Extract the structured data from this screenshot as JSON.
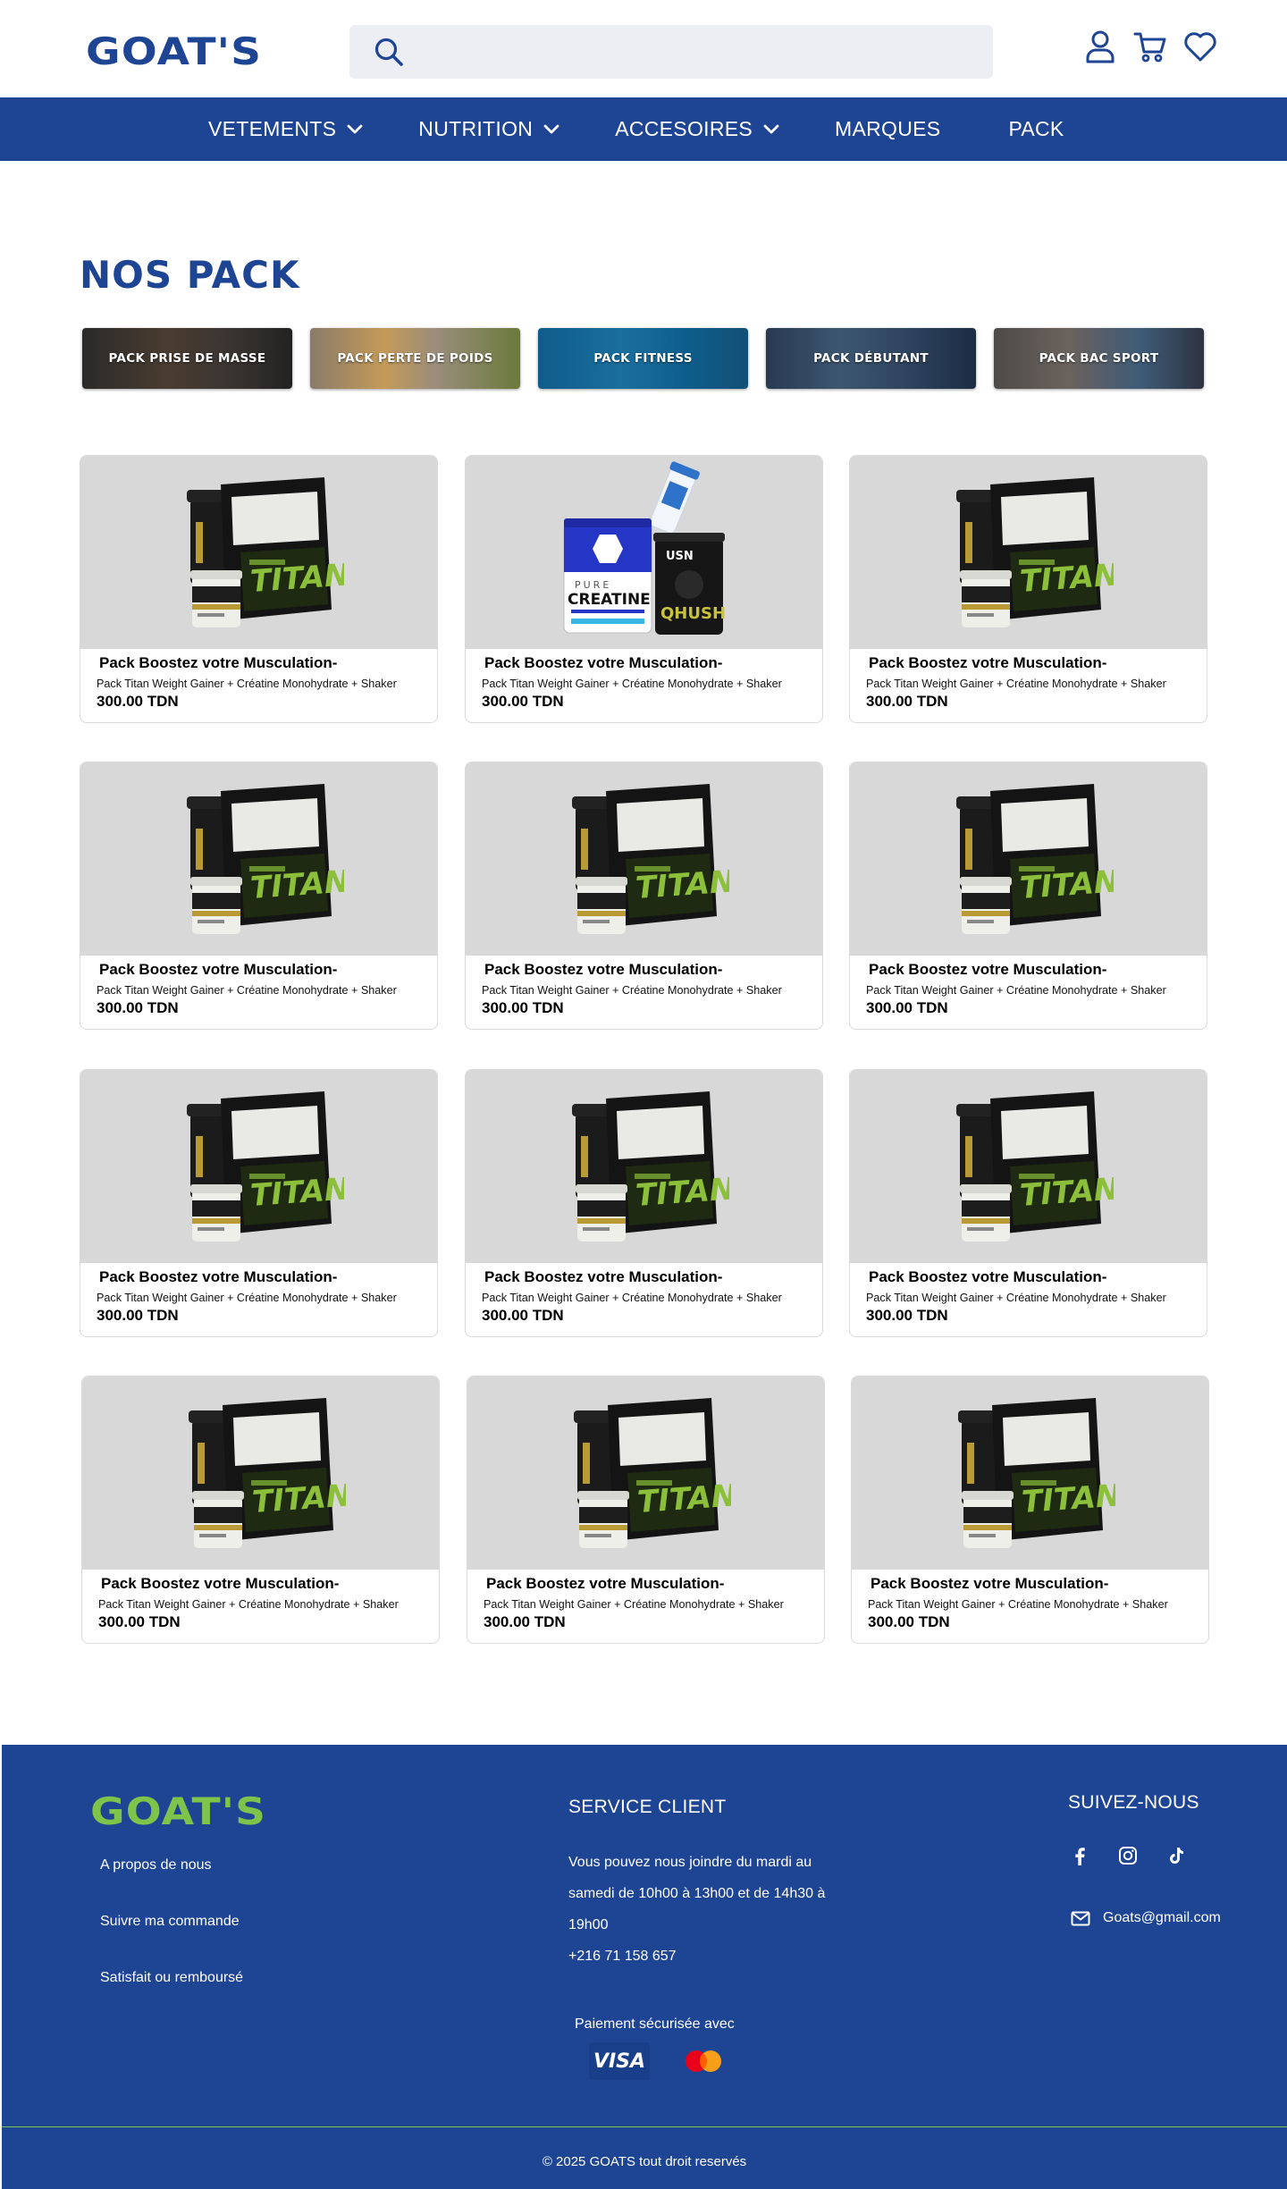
{
  "brand": {
    "logo_text": "GOAT'S",
    "primary_color": "#1e4494",
    "accent_color": "#7ec44b"
  },
  "search": {
    "placeholder": ""
  },
  "header_icons": [
    "user-icon",
    "cart-icon",
    "heart-icon"
  ],
  "nav": {
    "items": [
      {
        "label": "VETEMENTS",
        "has_dropdown": true
      },
      {
        "label": "NUTRITION",
        "has_dropdown": true
      },
      {
        "label": "ACCESOIRES",
        "has_dropdown": true
      },
      {
        "label": "MARQUES",
        "has_dropdown": false
      },
      {
        "label": "PACK",
        "has_dropdown": false
      }
    ]
  },
  "page": {
    "title": "NOS PACK"
  },
  "categories": [
    {
      "label": "PACK PRISE DE MASSE"
    },
    {
      "label": "PACK PERTE DE POIDS"
    },
    {
      "label": "PACK FITNESS"
    },
    {
      "label": "PACK DÉBUTANT"
    },
    {
      "label": "PACK BAC SPORT"
    }
  ],
  "products": [
    {
      "name": "Pack Boostez votre Musculation-",
      "desc": "Pack Titan Weight Gainer + Créatine Monohydrate + Shaker",
      "price": "300.00 TDN",
      "image": "titan"
    },
    {
      "name": "Pack Boostez votre Musculation-",
      "desc": "Pack Titan Weight Gainer + Créatine Monohydrate + Shaker",
      "price": "300.00 TDN",
      "image": "creatine"
    },
    {
      "name": "Pack Boostez votre Musculation-",
      "desc": "Pack Titan Weight Gainer + Créatine Monohydrate + Shaker",
      "price": "300.00 TDN",
      "image": "titan"
    },
    {
      "name": "Pack Boostez votre Musculation-",
      "desc": "Pack Titan Weight Gainer + Créatine Monohydrate + Shaker",
      "price": "300.00 TDN",
      "image": "titan"
    },
    {
      "name": "Pack Boostez votre Musculation-",
      "desc": "Pack Titan Weight Gainer + Créatine Monohydrate + Shaker",
      "price": "300.00 TDN",
      "image": "titan"
    },
    {
      "name": "Pack Boostez votre Musculation-",
      "desc": "Pack Titan Weight Gainer + Créatine Monohydrate + Shaker",
      "price": "300.00 TDN",
      "image": "titan"
    },
    {
      "name": "Pack Boostez votre Musculation-",
      "desc": "Pack Titan Weight Gainer + Créatine Monohydrate + Shaker",
      "price": "300.00 TDN",
      "image": "titan"
    },
    {
      "name": "Pack Boostez votre Musculation-",
      "desc": "Pack Titan Weight Gainer + Créatine Monohydrate + Shaker",
      "price": "300.00 TDN",
      "image": "titan"
    },
    {
      "name": "Pack Boostez votre Musculation-",
      "desc": "Pack Titan Weight Gainer + Créatine Monohydrate + Shaker",
      "price": "300.00 TDN",
      "image": "titan"
    },
    {
      "name": "Pack Boostez votre Musculation-",
      "desc": "Pack Titan Weight Gainer + Créatine Monohydrate + Shaker",
      "price": "300.00 TDN",
      "image": "titan"
    },
    {
      "name": "Pack Boostez votre Musculation-",
      "desc": "Pack Titan Weight Gainer + Créatine Monohydrate + Shaker",
      "price": "300.00 TDN",
      "image": "titan"
    },
    {
      "name": "Pack Boostez votre Musculation-",
      "desc": "Pack Titan Weight Gainer + Créatine Monohydrate + Shaker",
      "price": "300.00 TDN",
      "image": "titan"
    }
  ],
  "footer": {
    "logo_text": "GOAT'S",
    "links": [
      "A propos de nous",
      "Suivre ma commande",
      "Satisfait ou remboursé"
    ],
    "service": {
      "title": "SERVICE CLIENT",
      "line1": "Vous pouvez nous joindre du mardi au",
      "line2": "samedi de 10h00 à 13h00 et de 14h30 à",
      "line3": "19h00",
      "phone": "+216 71 158 657"
    },
    "social": {
      "title": "SUIVEZ-NOUS",
      "icons": [
        "facebook-icon",
        "instagram-icon",
        "tiktok-icon"
      ],
      "email": "Goats@gmail.com"
    },
    "payment": {
      "label": "Paiement sécurisée avec",
      "visa": "VISA"
    },
    "copyright": "© 2025 GOATS tout droit reservés"
  }
}
